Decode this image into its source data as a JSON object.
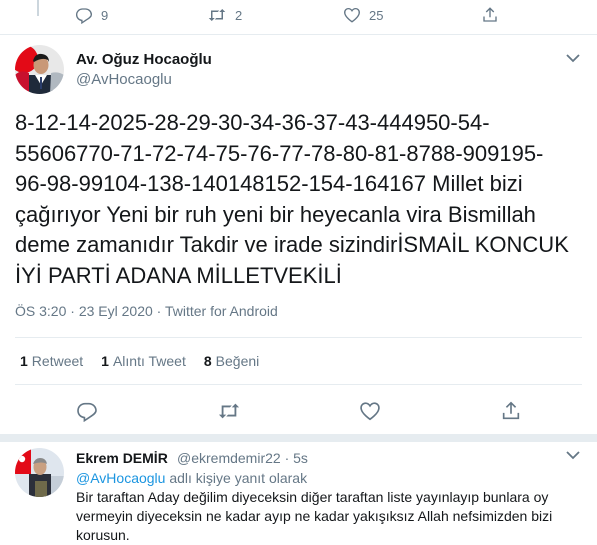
{
  "previous_tweet": {
    "reply_count": "9",
    "retweet_count": "2",
    "like_count": "25"
  },
  "main_tweet": {
    "display_name": "Av. Oğuz Hocaoğlu",
    "handle": "@AvHocaoglu",
    "text": "8-12-14-2025-28-29-30-34-36-37-43-444950-54-\n55606770-71-72-74-75-76-77-78-80-81-8788-909195-\n96-98-99104-138-140148152-154-164167 Millet bizi\nçağırıyor Yeni bir ruh yeni bir heyecanla vira Bismillah\ndeme zamanıdır Takdir ve irade sizindirİSMAİL KONCUK\nİYİ PARTİ ADANA MİLLETVEKİLİ",
    "time": "ÖS 3:20",
    "date": "23 Eyl 2020",
    "source": "Twitter for Android",
    "meta_sep": "·",
    "stats": [
      {
        "count": "1",
        "label": "Retweet"
      },
      {
        "count": "1",
        "label": "Alıntı Tweet"
      },
      {
        "count": "8",
        "label": "Beğeni"
      }
    ]
  },
  "reply": {
    "display_name": "Ekrem DEMİR",
    "handle": "@ekremdemir22",
    "time": "5s",
    "sep": "·",
    "reply_to_handle": "@AvHocaoglu",
    "reply_to_suffix": "adlı kişiye yanıt olarak",
    "text": "Bir taraftan Aday değilim diyeceksin diğer taraftan liste yayınlayıp bunlara oy vermeyin diyeceksin ne kadar ayıp ne kadar yakışıksız Allah nefsimizden bizi korusun."
  },
  "icons": {
    "reply": "reply-icon",
    "retweet": "retweet-icon",
    "like": "heart-icon",
    "share": "share-icon",
    "more": "chevron-down-icon"
  },
  "colors": {
    "text": "#14171a",
    "muted": "#657786",
    "link": "#1b95e0",
    "border": "#e6ecf0"
  }
}
